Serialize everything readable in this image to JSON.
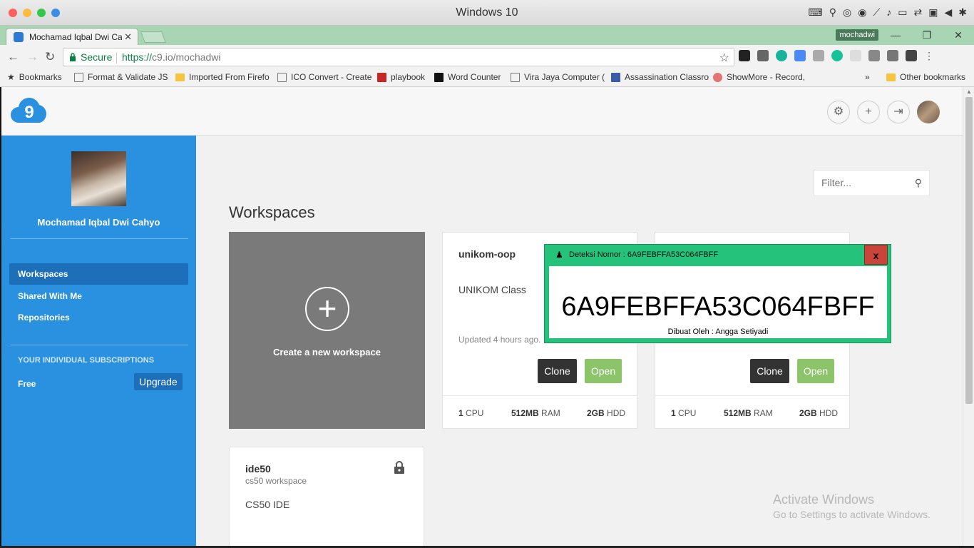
{
  "os_window": {
    "title": "Windows 10",
    "status_icons": [
      "keyboard-icon",
      "usb-icon",
      "camera-icon",
      "screen-icon",
      "display-icon",
      "volume-icon",
      "tablet-icon",
      "arrows-icon",
      "window-icon",
      "triangle-icon",
      "gear-icon"
    ]
  },
  "browser": {
    "tab_title": "Mochamad Iqbal Dwi Ca",
    "profile_name": "mochadwi",
    "url_secure_label": "Secure",
    "url_protocol": "https://",
    "url_host": "c9.io/mochadwi",
    "bookmarks": [
      {
        "label": "Bookmarks",
        "icon": "star-icon"
      },
      {
        "label": "Format & Validate JS",
        "icon": "page-icon"
      },
      {
        "label": "Imported From Firefo",
        "icon": "folder-icon"
      },
      {
        "label": "ICO Convert - Create",
        "icon": "page-icon"
      },
      {
        "label": "playbook",
        "icon": "playbook-icon"
      },
      {
        "label": "Word Counter",
        "icon": "w-icon"
      },
      {
        "label": "Vira Jaya Computer (",
        "icon": "page-icon"
      },
      {
        "label": "Assassination Classro",
        "icon": "as-icon"
      },
      {
        "label": "ShowMore - Record,",
        "icon": "showmore-icon"
      }
    ],
    "bookmarks_more": "»",
    "other_bookmarks": "Other bookmarks"
  },
  "sidebar": {
    "user_name": "Mochamad Iqbal Dwi Cahyo",
    "nav": [
      "Workspaces",
      "Shared With Me",
      "Repositories"
    ],
    "subscriptions_heading": "YOUR INDIVIDUAL SUBSCRIPTIONS",
    "plan": "Free",
    "upgrade_label": "Upgrade"
  },
  "main": {
    "filter_placeholder": "Filter...",
    "title": "Workspaces",
    "create_label": "Create a new workspace",
    "cards": [
      {
        "name": "unikom-oop",
        "desc": "UNIKOM Class",
        "updated": "Updated 4 hours ago.",
        "clone": "Clone",
        "open": "Open",
        "cpu": "1",
        "ram": "512MB",
        "hdd": "2GB"
      },
      {
        "clone": "Clone",
        "open": "Open",
        "cpu": "1",
        "ram": "512MB",
        "hdd": "2GB"
      },
      {
        "name": "ide50",
        "sub": "cs50 workspace",
        "desc": "CS50 IDE"
      }
    ],
    "spec_units": {
      "cpu": "CPU",
      "ram": "RAM",
      "hdd": "HDD"
    }
  },
  "popup": {
    "title": "Deteksi Nomor : 6A9FEBFFA53C064FBFF",
    "number": "6A9FEBFFA53C064FBFF",
    "credit": "Dibuat Oleh : Angga Setiyadi",
    "close": "x"
  },
  "watermark": {
    "line1": "Activate Windows",
    "line2": "Go to Settings to activate Windows."
  },
  "colors": {
    "sidebar": "#2a90e0",
    "sidebar_active": "#1c6fb8",
    "open_button": "#8cc46a",
    "popup_frame": "#24c27a"
  }
}
